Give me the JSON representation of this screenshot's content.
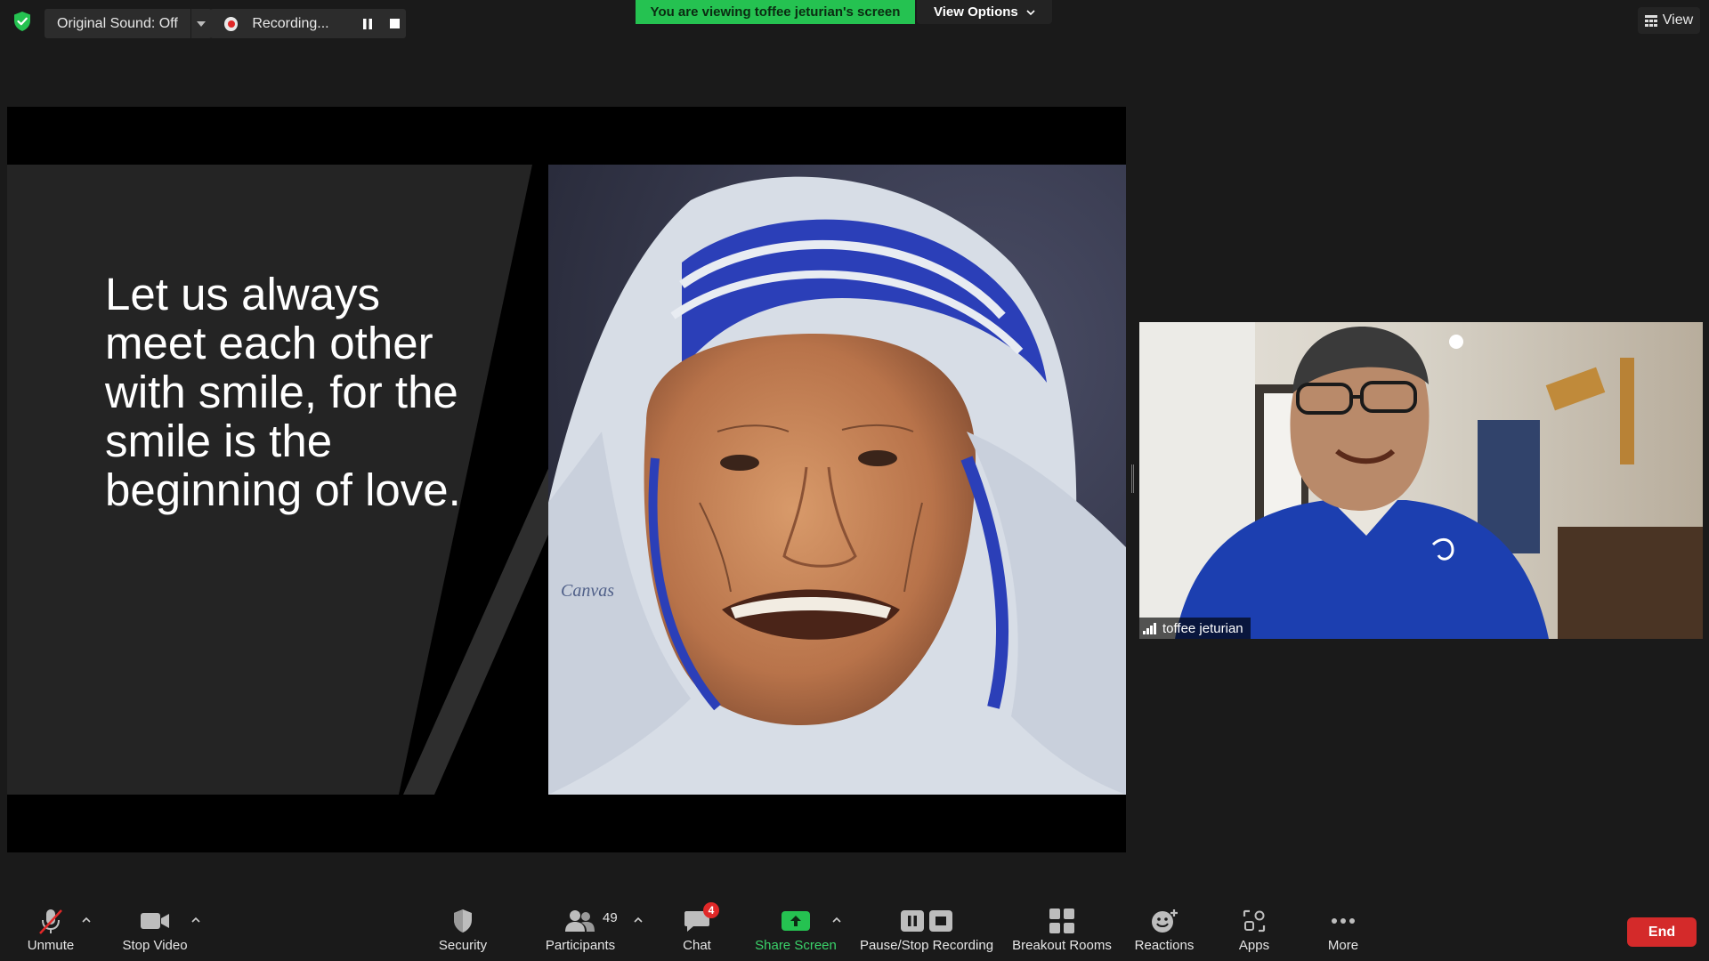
{
  "top_bar": {
    "original_sound_label": "Original Sound: Off",
    "recording_label": "Recording...",
    "viewing_banner": "You are viewing toffee jeturian's screen",
    "view_options_label": "View Options",
    "view_label": "View"
  },
  "slide": {
    "quote": "Let us always meet each other with smile, for the smile is the beginning of love.",
    "signature": "Canvas"
  },
  "participant": {
    "name": "toffee jeturian"
  },
  "toolbar": {
    "unmute": "Unmute",
    "stop_video": "Stop Video",
    "security": "Security",
    "participants": "Participants",
    "participants_count": "49",
    "chat": "Chat",
    "chat_badge": "4",
    "share_screen": "Share Screen",
    "pause_stop_recording": "Pause/Stop Recording",
    "breakout_rooms": "Breakout Rooms",
    "reactions": "Reactions",
    "apps": "Apps",
    "more": "More",
    "end": "End"
  },
  "colors": {
    "background": "#1a1a1a",
    "banner_green": "#25c251",
    "share_green": "#3ad36a",
    "end_red": "#d42a2a",
    "badge_red": "#e02828",
    "veil_blue": "#2b3fb8"
  },
  "icons": [
    "shield-icon",
    "chevron-down-icon",
    "record-icon",
    "pause-icon",
    "stop-icon",
    "grid-icon",
    "microphone-muted-icon",
    "camera-icon",
    "shield-icon",
    "people-icon",
    "chat-icon",
    "share-arrow-icon",
    "pause-stop-icon",
    "breakout-grid-icon",
    "reaction-smiley-icon",
    "apps-icon",
    "ellipsis-icon",
    "signal-bars-icon"
  ]
}
